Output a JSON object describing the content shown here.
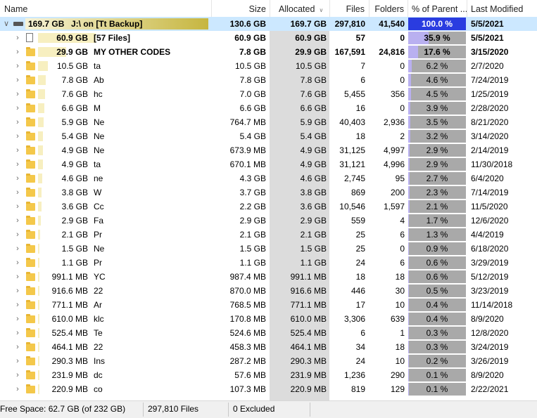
{
  "columns": {
    "name": "Name",
    "size": "Size",
    "allocated": "Allocated",
    "files": "Files",
    "folders": "Folders",
    "pct": "% of Parent ...",
    "modified": "Last Modified"
  },
  "accent": {
    "selected_row": "#cce8ff",
    "size_bar": "#f7efc0",
    "pct_root": "#2a3ce0",
    "pct_bar": "#b9b0f0",
    "pct_bg": "#a9a9a9"
  },
  "root": {
    "size_label": "169.7 GB",
    "name": "J:\\  on  [Tt Backup]",
    "size": "130.6 GB",
    "allocated": "169.7 GB",
    "files": "297,810",
    "folders": "41,540",
    "pct": "100.0 %",
    "pct_value": 100.0,
    "modified": "5/5/2021"
  },
  "rows": [
    {
      "icon": "file-icon",
      "size_label": "60.9 GB",
      "name": "[57 Files]",
      "size": "60.9 GB",
      "allocated": "60.9 GB",
      "files": "57",
      "folders": "0",
      "pct": "35.9 %",
      "pct_value": 35.9,
      "modified": "5/5/2021",
      "bold": true
    },
    {
      "icon": "folder-icon",
      "size_label": "29.9 GB",
      "name": "MY OTHER CODES",
      "size": "7.8 GB",
      "allocated": "29.9 GB",
      "files": "167,591",
      "folders": "24,816",
      "pct": "17.6 %",
      "pct_value": 17.6,
      "modified": "3/15/2020",
      "bold": true
    },
    {
      "icon": "folder-icon",
      "size_label": "10.5 GB",
      "name": "ta",
      "size": "10.5 GB",
      "allocated": "10.5 GB",
      "files": "7",
      "folders": "0",
      "pct": "6.2 %",
      "pct_value": 6.2,
      "modified": "2/7/2020"
    },
    {
      "icon": "folder-icon",
      "size_label": "7.8 GB",
      "name": "Ab",
      "size": "7.8 GB",
      "allocated": "7.8 GB",
      "files": "6",
      "folders": "0",
      "pct": "4.6 %",
      "pct_value": 4.6,
      "modified": "7/24/2019"
    },
    {
      "icon": "folder-icon",
      "size_label": "7.6 GB",
      "name": "hc",
      "size": "7.0 GB",
      "allocated": "7.6 GB",
      "files": "5,455",
      "folders": "356",
      "pct": "4.5 %",
      "pct_value": 4.5,
      "modified": "1/25/2019"
    },
    {
      "icon": "folder-icon",
      "size_label": "6.6 GB",
      "name": "M",
      "size": "6.6 GB",
      "allocated": "6.6 GB",
      "files": "16",
      "folders": "0",
      "pct": "3.9 %",
      "pct_value": 3.9,
      "modified": "2/28/2020"
    },
    {
      "icon": "folder-icon",
      "size_label": "5.9 GB",
      "name": "Ne",
      "size": "764.7 MB",
      "allocated": "5.9 GB",
      "files": "40,403",
      "folders": "2,936",
      "pct": "3.5 %",
      "pct_value": 3.5,
      "modified": "8/21/2020"
    },
    {
      "icon": "folder-icon",
      "size_label": "5.4 GB",
      "name": "Ne",
      "size": "5.4 GB",
      "allocated": "5.4 GB",
      "files": "18",
      "folders": "2",
      "pct": "3.2 %",
      "pct_value": 3.2,
      "modified": "3/14/2020"
    },
    {
      "icon": "folder-icon",
      "size_label": "4.9 GB",
      "name": "Ne",
      "size": "673.9 MB",
      "allocated": "4.9 GB",
      "files": "31,125",
      "folders": "4,997",
      "pct": "2.9 %",
      "pct_value": 2.9,
      "modified": "2/14/2019"
    },
    {
      "icon": "folder-icon",
      "size_label": "4.9 GB",
      "name": "ta",
      "size": "670.1 MB",
      "allocated": "4.9 GB",
      "files": "31,121",
      "folders": "4,996",
      "pct": "2.9 %",
      "pct_value": 2.9,
      "modified": "11/30/2018"
    },
    {
      "icon": "folder-icon",
      "size_label": "4.6 GB",
      "name": "ne",
      "size": "4.3 GB",
      "allocated": "4.6 GB",
      "files": "2,745",
      "folders": "95",
      "pct": "2.7 %",
      "pct_value": 2.7,
      "modified": "6/4/2020"
    },
    {
      "icon": "folder-icon",
      "size_label": "3.8 GB",
      "name": "W",
      "size": "3.7 GB",
      "allocated": "3.8 GB",
      "files": "869",
      "folders": "200",
      "pct": "2.3 %",
      "pct_value": 2.3,
      "modified": "7/14/2019"
    },
    {
      "icon": "folder-icon",
      "size_label": "3.6 GB",
      "name": "Cc",
      "size": "2.2 GB",
      "allocated": "3.6 GB",
      "files": "10,546",
      "folders": "1,597",
      "pct": "2.1 %",
      "pct_value": 2.1,
      "modified": "11/5/2020"
    },
    {
      "icon": "folder-icon",
      "size_label": "2.9 GB",
      "name": "Fa",
      "size": "2.9 GB",
      "allocated": "2.9 GB",
      "files": "559",
      "folders": "4",
      "pct": "1.7 %",
      "pct_value": 1.7,
      "modified": "12/6/2020"
    },
    {
      "icon": "folder-icon",
      "size_label": "2.1 GB",
      "name": "Pr",
      "size": "2.1 GB",
      "allocated": "2.1 GB",
      "files": "25",
      "folders": "6",
      "pct": "1.3 %",
      "pct_value": 1.3,
      "modified": "4/4/2019"
    },
    {
      "icon": "folder-icon",
      "size_label": "1.5 GB",
      "name": "Ne",
      "size": "1.5 GB",
      "allocated": "1.5 GB",
      "files": "25",
      "folders": "0",
      "pct": "0.9 %",
      "pct_value": 0.9,
      "modified": "6/18/2020"
    },
    {
      "icon": "folder-icon",
      "size_label": "1.1 GB",
      "name": "Pr",
      "size": "1.1 GB",
      "allocated": "1.1 GB",
      "files": "24",
      "folders": "6",
      "pct": "0.6 %",
      "pct_value": 0.6,
      "modified": "3/29/2019"
    },
    {
      "icon": "folder-icon",
      "size_label": "991.1 MB",
      "name": "YC",
      "size": "987.4 MB",
      "allocated": "991.1 MB",
      "files": "18",
      "folders": "18",
      "pct": "0.6 %",
      "pct_value": 0.6,
      "modified": "5/12/2019"
    },
    {
      "icon": "folder-icon",
      "size_label": "916.6 MB",
      "name": "22",
      "size": "870.0 MB",
      "allocated": "916.6 MB",
      "files": "446",
      "folders": "30",
      "pct": "0.5 %",
      "pct_value": 0.5,
      "modified": "3/23/2019"
    },
    {
      "icon": "folder-icon",
      "size_label": "771.1 MB",
      "name": "Ar",
      "size": "768.5 MB",
      "allocated": "771.1 MB",
      "files": "17",
      "folders": "10",
      "pct": "0.4 %",
      "pct_value": 0.4,
      "modified": "11/14/2018"
    },
    {
      "icon": "folder-icon",
      "size_label": "610.0 MB",
      "name": "klc",
      "size": "170.8 MB",
      "allocated": "610.0 MB",
      "files": "3,306",
      "folders": "639",
      "pct": "0.4 %",
      "pct_value": 0.4,
      "modified": "8/9/2020"
    },
    {
      "icon": "folder-icon",
      "size_label": "525.4 MB",
      "name": "Te",
      "size": "524.6 MB",
      "allocated": "525.4 MB",
      "files": "6",
      "folders": "1",
      "pct": "0.3 %",
      "pct_value": 0.3,
      "modified": "12/8/2020"
    },
    {
      "icon": "folder-icon",
      "size_label": "464.1 MB",
      "name": "22",
      "size": "458.3 MB",
      "allocated": "464.1 MB",
      "files": "34",
      "folders": "18",
      "pct": "0.3 %",
      "pct_value": 0.3,
      "modified": "3/24/2019"
    },
    {
      "icon": "folder-icon",
      "size_label": "290.3 MB",
      "name": "Ins",
      "size": "287.2 MB",
      "allocated": "290.3 MB",
      "files": "24",
      "folders": "10",
      "pct": "0.2 %",
      "pct_value": 0.2,
      "modified": "3/26/2019"
    },
    {
      "icon": "folder-icon",
      "size_label": "231.9 MB",
      "name": "dc",
      "size": "57.6 MB",
      "allocated": "231.9 MB",
      "files": "1,236",
      "folders": "290",
      "pct": "0.1 %",
      "pct_value": 0.1,
      "modified": "8/9/2020"
    },
    {
      "icon": "folder-icon",
      "size_label": "220.9 MB",
      "name": "co",
      "size": "107.3 MB",
      "allocated": "220.9 MB",
      "files": "819",
      "folders": "129",
      "pct": "0.1 %",
      "pct_value": 0.1,
      "modified": "2/22/2021"
    }
  ],
  "status": {
    "free_space": "Free Space: 62.7 GB  (of 232 GB)",
    "files": "297,810 Files",
    "excluded": "0 Excluded"
  }
}
